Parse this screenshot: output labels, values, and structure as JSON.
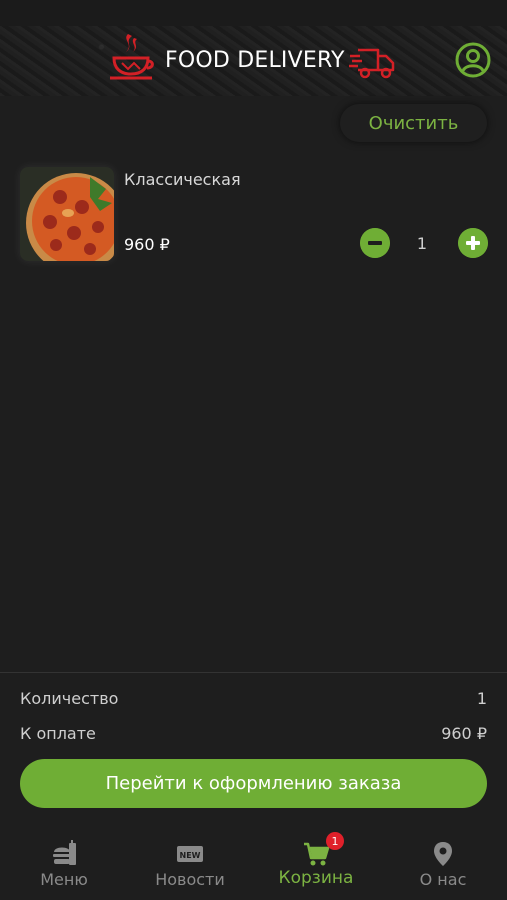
{
  "header": {
    "brand": "FOOD DELIVERY",
    "logo_icon": "steaming-cup-icon",
    "truck_icon": "delivery-truck-icon",
    "profile_icon": "user-circle-icon"
  },
  "cart": {
    "clear_label": "Очистить",
    "items": [
      {
        "name": "Классическая",
        "price": "960 ₽",
        "quantity": "1"
      }
    ]
  },
  "summary": {
    "quantity_label": "Количество",
    "quantity_value": "1",
    "total_label": "К оплате",
    "total_value": "960 ₽",
    "checkout_label": "Перейти к оформлению заказа"
  },
  "nav": {
    "items": [
      {
        "label": "Меню",
        "icon": "food-bag-icon"
      },
      {
        "label": "Новости",
        "icon": "new-badge-icon"
      },
      {
        "label": "Корзина",
        "icon": "cart-icon",
        "badge": "1",
        "active": true
      },
      {
        "label": "О нас",
        "icon": "location-pin-icon"
      }
    ]
  },
  "colors": {
    "accent_green": "#6fae35",
    "brand_red": "#e0202a",
    "background": "#1e1e1e"
  }
}
